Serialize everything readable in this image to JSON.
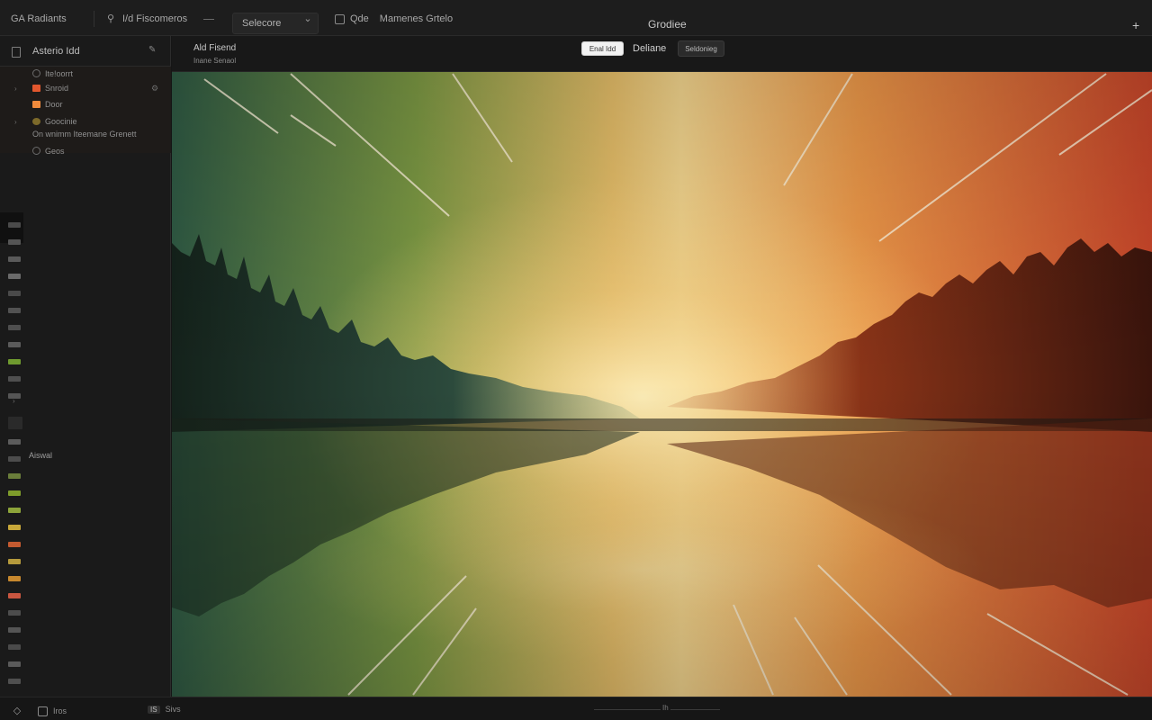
{
  "topbar": {
    "app_label": "GA Radiants",
    "tool_label": "I/d Fiscomeros",
    "select_label": "Selecore",
    "view_label": "Qde",
    "view_name": "Mamenes Grtelo",
    "title": "Grodiee"
  },
  "sidebar": {
    "title": "Asterio Idd",
    "items": [
      {
        "label": "Ite!oorrt"
      },
      {
        "label": "Snroid",
        "color": "#e2572e"
      },
      {
        "label": "Door",
        "color": "#f08a3c"
      },
      {
        "label": "Goocinie"
      },
      {
        "label": "On wnimm Iteemane Grenett"
      },
      {
        "label": "Geos"
      }
    ],
    "strip_label": "Aiswal",
    "swatches_top": [
      "#4a4a4a",
      "#555555",
      "#5a5a5a",
      "#6a6a6a",
      "#4a4a4a",
      "#525252",
      "#4e4e4e",
      "#5b5b5b",
      "#6f9a2f",
      "#4f4f4f",
      "#555555"
    ],
    "swatches_bottom": [
      "#5c5c5c",
      "#4c4c4c",
      "#6a7d3a",
      "#7e9c2b",
      "#8da43a",
      "#c8a83a",
      "#c45a30",
      "#b59a3c",
      "#c7882e",
      "#c95640",
      "#4d4d4d",
      "#555555",
      "#4a4a4a",
      "#5a5a5a",
      "#4f4f4f"
    ]
  },
  "canvas_toolbar": {
    "title": "Ald Fisend",
    "subtitle": "Inane Senaol",
    "active_button": "Enal Idd",
    "label": "Deliane",
    "button": "Seldonieg"
  },
  "statusbar": {
    "left_label": "Iros",
    "badge": "IS",
    "badge_label": "Sivs",
    "center": "Ih"
  },
  "colors": {
    "background": "#151515",
    "panel": "#1a1a1a",
    "accent_orange": "#e2572e"
  }
}
